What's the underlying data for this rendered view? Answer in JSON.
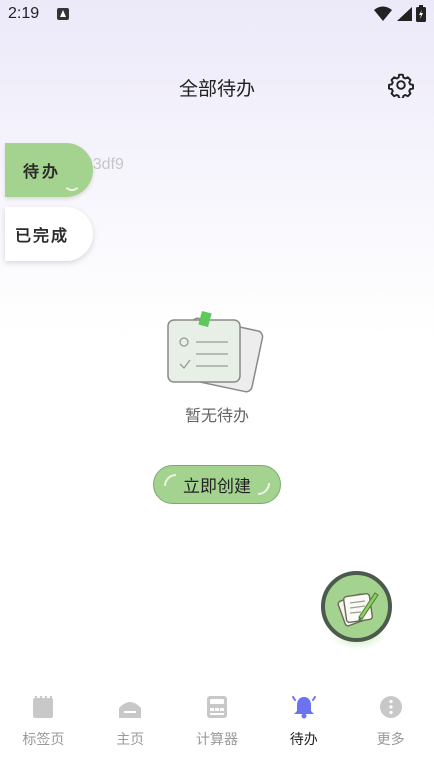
{
  "status_bar": {
    "time": "2:19"
  },
  "header": {
    "title": "全部待办"
  },
  "tabs": {
    "todo_label": "待办",
    "done_label": "已完成",
    "ghost_text": "ecd33df9"
  },
  "empty_state": {
    "message": "暂无待办",
    "create_label": "立即创建"
  },
  "bottom_nav": {
    "items": [
      {
        "label": "标签页",
        "icon": "notebook-icon"
      },
      {
        "label": "主页",
        "icon": "home-icon"
      },
      {
        "label": "计算器",
        "icon": "calculator-icon"
      },
      {
        "label": "待办",
        "icon": "bell-icon",
        "active": true
      },
      {
        "label": "更多",
        "icon": "more-icon"
      }
    ]
  },
  "colors": {
    "accent_green": "#a3d38f",
    "active_icon": "#6b73f0",
    "inactive_icon": "#c8c8c8"
  }
}
